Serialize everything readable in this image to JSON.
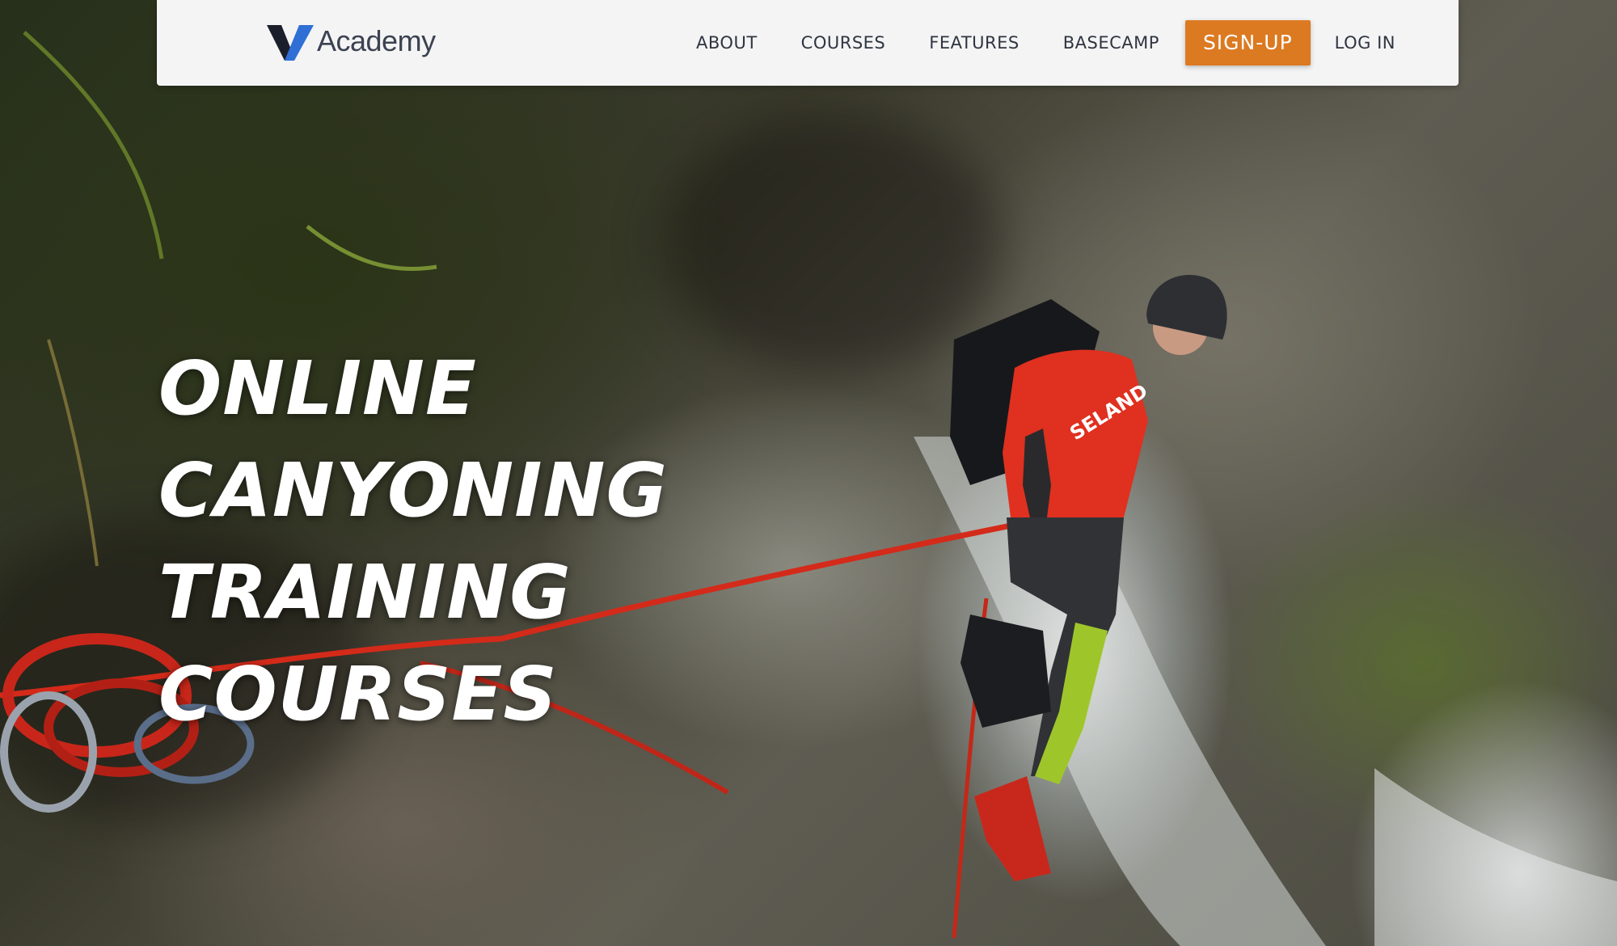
{
  "logo": {
    "brand": "Academy",
    "icon": "v-logo-icon",
    "brand_colors": [
      "#1a1f2b",
      "#2f6fd6"
    ]
  },
  "nav": {
    "items": [
      {
        "label": "ABOUT"
      },
      {
        "label": "COURSES"
      },
      {
        "label": "FEATURES"
      },
      {
        "label": "BASECAMP"
      }
    ],
    "signup_label": "SIGN-UP",
    "login_label": "LOG IN",
    "accent_color": "#dc7a22"
  },
  "hero": {
    "title_lines": [
      "ONLINE",
      "CANYONING",
      "TRAINING",
      "COURSES"
    ],
    "photo_subject": "canyoneer rappelling beside a waterfall",
    "suit_text": "SELAND"
  }
}
